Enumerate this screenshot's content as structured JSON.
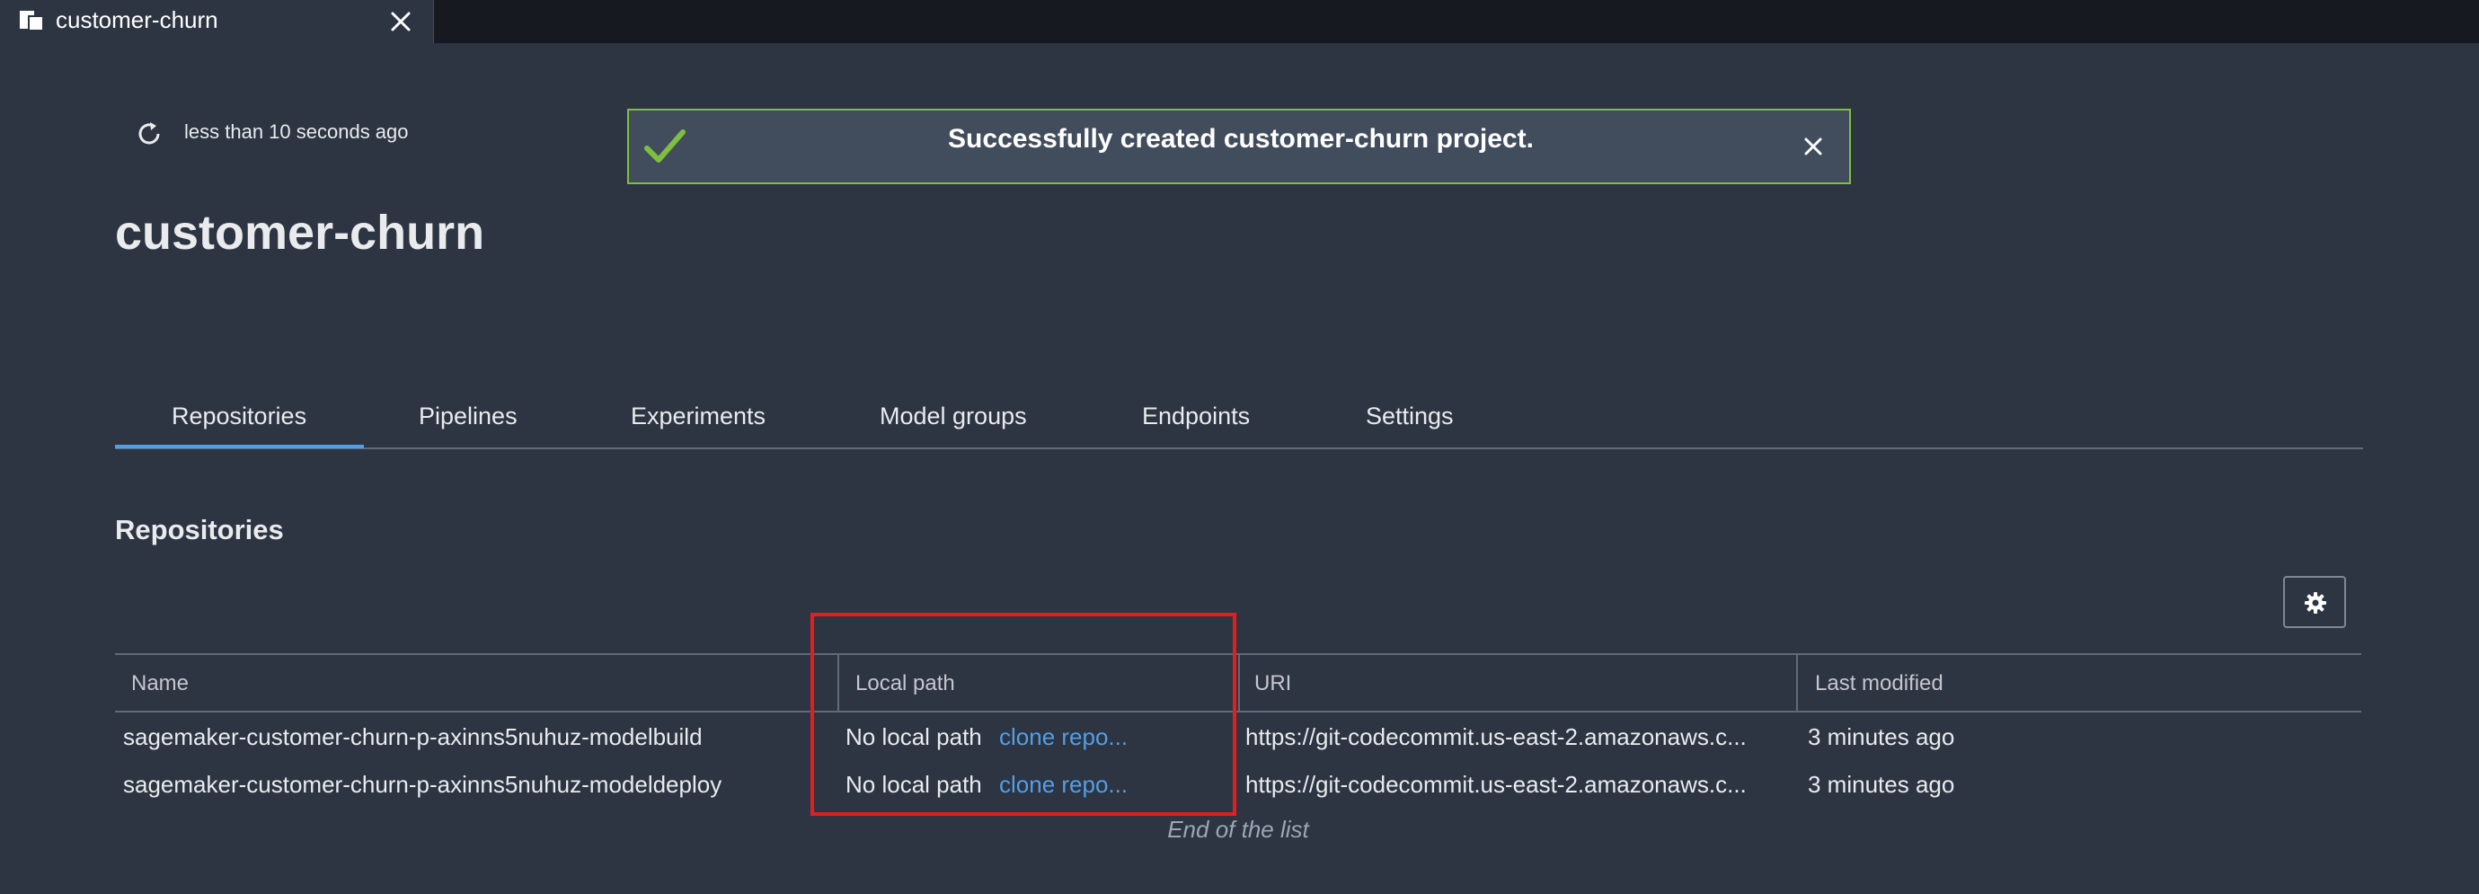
{
  "document_tab": {
    "label": "customer-churn",
    "icon": "document-icon"
  },
  "refresh": {
    "icon": "refresh-icon",
    "text": "less than 10 seconds ago"
  },
  "flash": {
    "icon": "check-icon",
    "message": "Successfully created customer-churn project.",
    "status_color": "#7fbf3f"
  },
  "page": {
    "title": "customer-churn"
  },
  "tabs": [
    {
      "label": "Repositories",
      "active": true
    },
    {
      "label": "Pipelines"
    },
    {
      "label": "Experiments"
    },
    {
      "label": "Model groups"
    },
    {
      "label": "Endpoints"
    },
    {
      "label": "Settings"
    }
  ],
  "section": {
    "title": "Repositories"
  },
  "table": {
    "columns": [
      "Name",
      "Local path",
      "URI",
      "Last modified"
    ],
    "rows": [
      {
        "name": "sagemaker-customer-churn-p-axinns5nuhuz-modelbuild",
        "local_path": "No local path",
        "action": "clone repo...",
        "uri": "https://git-codecommit.us-east-2.amazonaws.c...",
        "last_modified": "3 minutes ago"
      },
      {
        "name": "sagemaker-customer-churn-p-axinns5nuhuz-modeldeploy",
        "local_path": "No local path",
        "action": "clone repo...",
        "uri": "https://git-codecommit.us-east-2.amazonaws.c...",
        "last_modified": "3 minutes ago"
      }
    ],
    "footer": "End of the list"
  },
  "colors": {
    "background": "#2d3442",
    "link": "#539fe5",
    "highlight": "#e0201e",
    "active_tab": "#539fe5"
  }
}
